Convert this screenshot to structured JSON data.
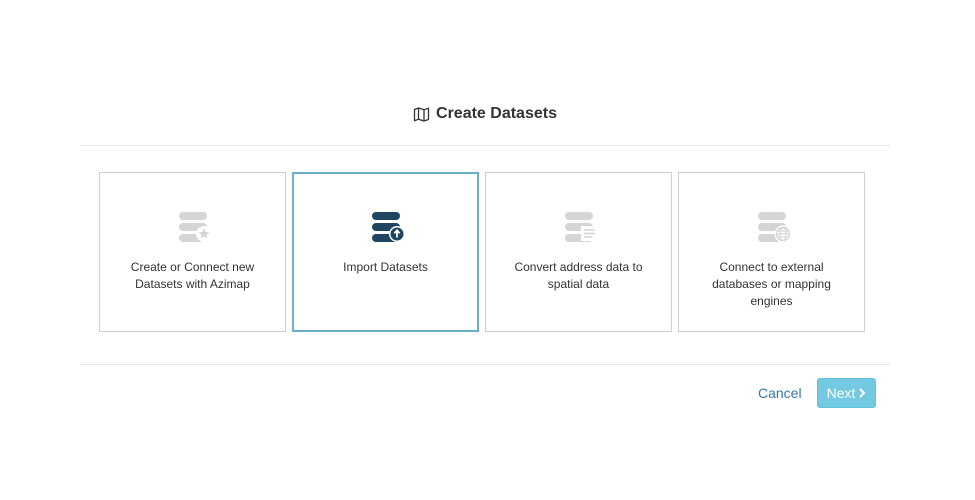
{
  "dialog": {
    "title": "Create Datasets",
    "title_icon": "map-icon"
  },
  "options": [
    {
      "label": "Create or Connect new Datasets with Azimap",
      "icon": "database-star-icon",
      "selected": false
    },
    {
      "label": "Import Datasets",
      "icon": "database-upload-icon",
      "selected": true
    },
    {
      "label": "Convert address data to spatial data",
      "icon": "database-list-icon",
      "selected": false
    },
    {
      "label": "Connect to external databases or mapping engines",
      "icon": "database-globe-icon",
      "selected": false
    }
  ],
  "footer": {
    "cancel_label": "Cancel",
    "next_label": "Next",
    "next_icon": "chevron-right-icon"
  },
  "colors": {
    "selected_border": "#6aaed0",
    "selected_icon": "#1f4561",
    "inactive_icon": "#d5d5d5",
    "next_button": "#5bc0de",
    "cancel_link": "#3478a8"
  }
}
